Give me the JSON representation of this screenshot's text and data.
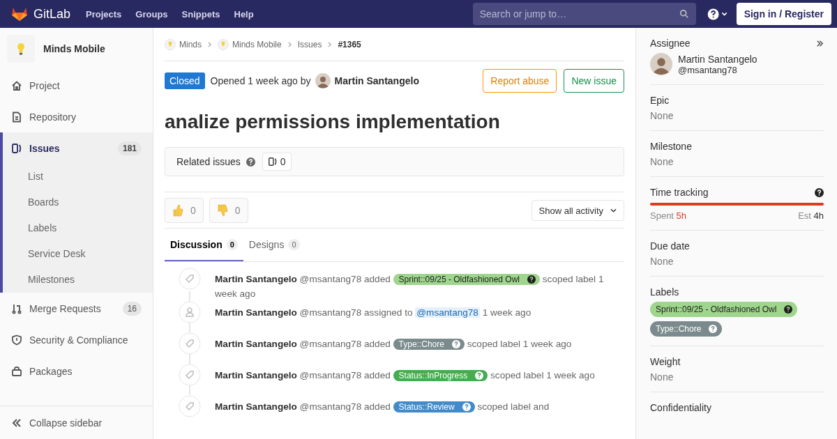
{
  "top_bar": {
    "brand": "GitLab",
    "nav": [
      {
        "label": "Projects"
      },
      {
        "label": "Groups"
      },
      {
        "label": "Snippets"
      },
      {
        "label": "Help"
      }
    ],
    "search": {
      "placeholder": "Search or jump to…"
    },
    "sign_in": "Sign in / Register"
  },
  "sidebar": {
    "project": "Minds Mobile",
    "items": [
      {
        "label": "Project",
        "selected": false
      },
      {
        "label": "Repository",
        "selected": false
      },
      {
        "label": "Issues",
        "selected": true,
        "count": "181",
        "children": [
          {
            "label": "List",
            "selected": false
          },
          {
            "label": "Boards",
            "selected": false
          },
          {
            "label": "Labels",
            "selected": false
          },
          {
            "label": "Service Desk",
            "selected": false
          },
          {
            "label": "Milestones",
            "selected": false
          }
        ]
      },
      {
        "label": "Merge Requests",
        "selected": false,
        "count": "16"
      },
      {
        "label": "Security & Compliance",
        "selected": false
      },
      {
        "label": "Packages",
        "selected": false
      }
    ],
    "collapse": "Collapse sidebar"
  },
  "breadcrumbs": [
    {
      "label": "Minds",
      "kind": "avatar"
    },
    {
      "label": "Minds Mobile",
      "kind": "avatar"
    },
    {
      "label": "Issues",
      "kind": "plain"
    },
    {
      "label": "#1365",
      "kind": "current"
    }
  ],
  "issue": {
    "status": "Closed",
    "opened": "Opened 1 week ago by",
    "author": "Martin Santangelo",
    "buttons": [
      {
        "label": "Report abuse",
        "kind": "warning"
      },
      {
        "label": "New issue",
        "kind": "success"
      }
    ],
    "title": "analize permissions implementation",
    "related": {
      "label": "Related issues",
      "count": "0"
    },
    "awards": [
      {
        "kind": "up",
        "count": "0"
      },
      {
        "kind": "down",
        "count": "0"
      }
    ],
    "activity_filter": "Show all activity",
    "tabs": [
      {
        "label": "Discussion",
        "count": "0",
        "selected": true
      },
      {
        "label": "Designs",
        "count": "0",
        "selected": false
      }
    ],
    "activity": [
      {
        "kind": "label",
        "author": "Martin Santangelo",
        "handle": "@msantang78",
        "action": "added",
        "label": {
          "text": "Sprint::09/25 - Oldfashioned Owl",
          "color": "#9fd68d"
        },
        "after": "scoped label",
        "time": "1 week ago"
      },
      {
        "kind": "assign",
        "author": "Martin Santangelo",
        "handle": "@msantang78",
        "action": "assigned to",
        "mention": "@msantang78",
        "time": "1 week ago"
      },
      {
        "kind": "label",
        "author": "Martin Santangelo",
        "handle": "@msantang78",
        "action": "added",
        "label": {
          "text": "Type::Chore",
          "color": "#7b8a8c"
        },
        "after": "scoped label",
        "time": "1 week ago"
      },
      {
        "kind": "label",
        "author": "Martin Santangelo",
        "handle": "@msantang78",
        "action": "added",
        "label": {
          "text": "Status::InProgress",
          "color": "#44ad4e"
        },
        "after": "scoped label",
        "time": "1 week ago"
      },
      {
        "kind": "label",
        "author": "Martin Santangelo",
        "handle": "@msantang78",
        "action": "added",
        "label": {
          "text": "Status::Review",
          "color": "#428bca"
        },
        "after": "scoped label and"
      }
    ]
  },
  "right_sidebar": {
    "assignee": {
      "title": "Assignee",
      "name": "Martin Santangelo",
      "handle": "@msantang78"
    },
    "sections": [
      {
        "title": "Epic",
        "value": "None"
      },
      {
        "title": "Milestone",
        "value": "None"
      }
    ],
    "time_tracking": {
      "title": "Time tracking",
      "spent_label": "Spent",
      "spent": "5h",
      "est_label": "Est",
      "est": "4h",
      "level": 1
    },
    "due": {
      "title": "Due date",
      "value": "None"
    },
    "labels": {
      "title": "Labels",
      "items": [
        {
          "text": "Sprint::09/25 - Oldfashioned Owl",
          "color": "#9fd68d"
        },
        {
          "text": "Type::Chore",
          "color": "#7b8a8c"
        }
      ]
    },
    "weight": {
      "title": "Weight",
      "value": "None"
    },
    "confidentiality": {
      "title": "Confidentiality"
    }
  }
}
